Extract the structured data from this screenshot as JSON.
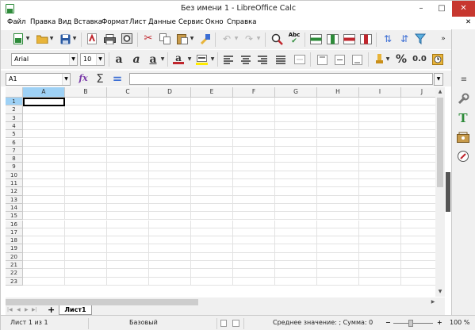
{
  "window": {
    "title": "Без имени 1 - LibreOffice Calc",
    "minimize": "–",
    "maximize": "□",
    "close": "✕"
  },
  "menubar": {
    "items": [
      "Файл",
      "Правка",
      "Вид",
      "Вставка",
      "Формат",
      "Лист",
      "Данные",
      "Сервис",
      "Окно",
      "Справка"
    ],
    "close_doc": "✕"
  },
  "toolbar_std": {
    "icons": [
      "new-icon",
      "open-icon",
      "save-icon",
      "export-pdf-icon",
      "print-icon",
      "print-preview-icon",
      "cut-icon",
      "copy-icon",
      "paste-icon",
      "clone-formatting-icon",
      "undo-icon",
      "redo-icon",
      "find-replace-icon",
      "spelling-icon",
      "row-icon",
      "column-icon",
      "insert-rows-icon",
      "insert-cols-icon",
      "sort-ascending-icon",
      "sort-descending-icon",
      "autofilter-icon"
    ]
  },
  "toolbar_fmt": {
    "font_name": "Arial",
    "font_size": "10",
    "bold_label": "a",
    "italic_label": "a",
    "underline_label": "a",
    "font_color_label": "a",
    "percent_label": "%",
    "number_label": "0.0"
  },
  "formula": {
    "name_box": "A1",
    "sum_label": "Σ",
    "equals_label": "=",
    "input_value": ""
  },
  "grid": {
    "columns": [
      "A",
      "B",
      "C",
      "D",
      "E",
      "F",
      "G",
      "H",
      "I",
      "J"
    ],
    "rows": [
      "1",
      "2",
      "3",
      "4",
      "5",
      "6",
      "7",
      "8",
      "9",
      "10",
      "11",
      "12",
      "13",
      "14",
      "15",
      "16",
      "17",
      "18",
      "19",
      "20",
      "21",
      "22",
      "23"
    ],
    "selected_cell": "A1"
  },
  "sheets": {
    "nav": [
      "|◀",
      "◀",
      "▶",
      "▶|"
    ],
    "add_label": "+",
    "tabs": [
      "Лист1"
    ]
  },
  "statusbar": {
    "sheet_info": "Лист 1 из 1",
    "page_style": "Базовый",
    "summary": "Среднее значение: ; Сумма: 0",
    "zoom": "100 %",
    "zoom_minus": "−",
    "zoom_plus": "+"
  },
  "colors": {
    "selected_header": "#9ed1f5",
    "chrome": "#f0f0f0",
    "grid_line": "#e2e2e2"
  }
}
